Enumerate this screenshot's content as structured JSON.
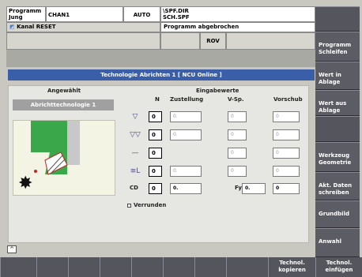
{
  "header": {
    "program_line1": "Programm",
    "program_line2": "Jung",
    "channel": "CHAN1",
    "mode": "AUTO",
    "path_line1": "\\SPF.DIR",
    "path_line2": "SCH.SPF",
    "channel_status": "Kanal RESET",
    "program_status": "Programm abgebrochen",
    "rov": "ROV"
  },
  "dialog": {
    "title": "Technologie Abrichten 1 [ NCU Online ]",
    "selected_label": "Angewählt",
    "selected_value": "Abrichttechnologie 1",
    "inputs_header": "Eingabewerte",
    "columns": [
      "N",
      "Zustellung",
      "V-Sp.",
      "Vorschub"
    ],
    "rows": [
      {
        "icon": "▽",
        "n": "0",
        "zustellung": "0.",
        "vsp": "0",
        "vorschub": "0"
      },
      {
        "icon": "▽▽",
        "n": "0",
        "zustellung": "0.",
        "vsp": "0",
        "vorschub": "0"
      },
      {
        "icon": "—",
        "n": "0",
        "zustellung": "",
        "vsp": "0",
        "vorschub": "0"
      },
      {
        "icon": "≡L",
        "n": "0",
        "zustellung": "0.",
        "vsp": "0",
        "vorschub": "0"
      }
    ],
    "cd_label": "CD",
    "cd_n": "0",
    "cd_zustellung": "0.",
    "fy_label": "Fy",
    "fy_value": "0.",
    "cd_vorschub": "0",
    "checkbox_label": "Verrunden"
  },
  "softkeys_right": [
    {
      "label": "",
      "empty": true
    },
    {
      "label": "Programm\nSchleifen"
    },
    {
      "label": "Wert in\nAblage"
    },
    {
      "label": "Wert aus\nAblage"
    },
    {
      "label": "",
      "empty": true
    },
    {
      "label": "Werkzeug\nGeometrie"
    },
    {
      "label": "Akt. Daten\nschreiben"
    },
    {
      "label": "Grundbild"
    },
    {
      "label": "Anwahl"
    }
  ],
  "softkeys_bottom": [
    "",
    "",
    "",
    "",
    "",
    "",
    "",
    "",
    "Technol.\nkopieren",
    "Technol.\neinfügen"
  ],
  "colors": {
    "title_bar": "#3b5ea8",
    "softkey": "#5c5c64",
    "panel": "#e6e6e2"
  }
}
